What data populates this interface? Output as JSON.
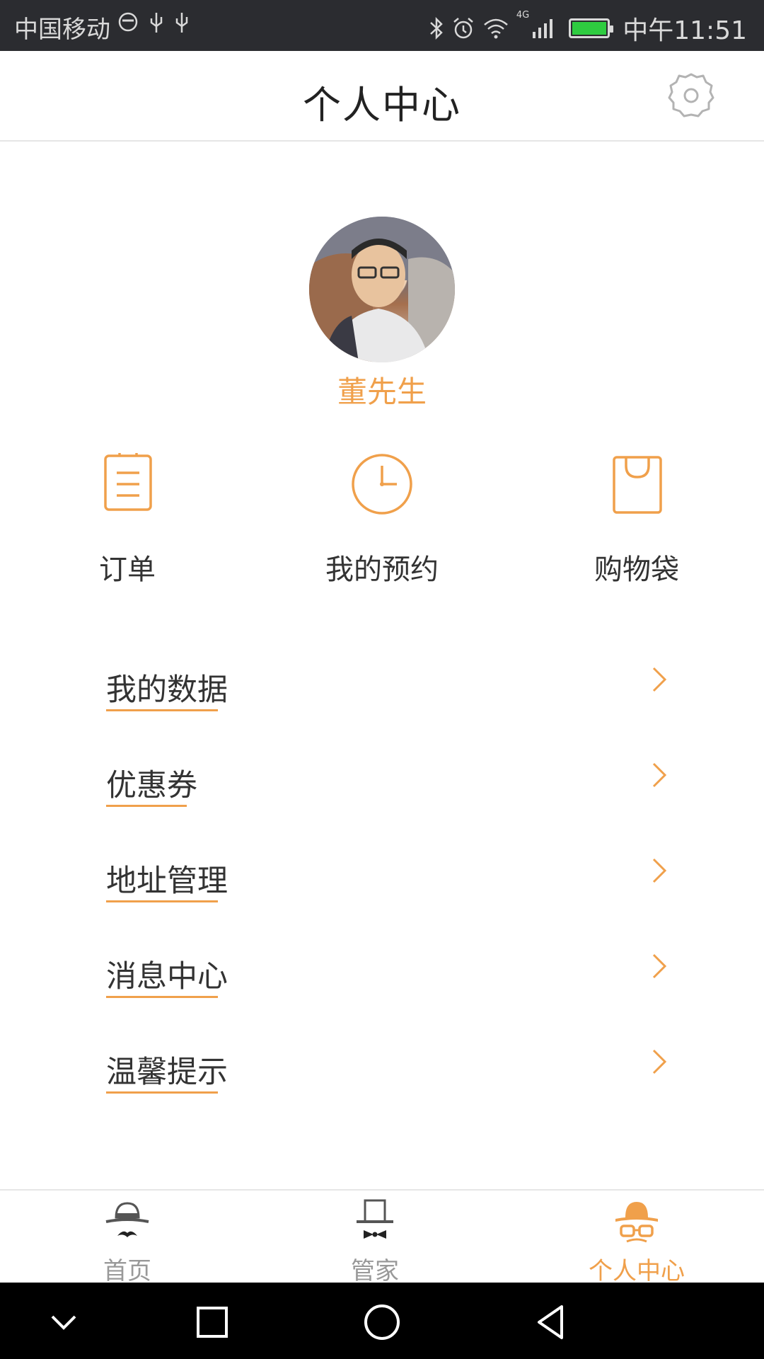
{
  "status_bar": {
    "carrier": "中国移动",
    "network": "4G",
    "time": "中午11:51",
    "battery_color": "#2ecc40"
  },
  "header": {
    "title": "个人中心",
    "settings_icon": "gear-icon"
  },
  "profile": {
    "name": "董先生",
    "name_color": "#f0a04b"
  },
  "quick_actions": [
    {
      "label": "订单",
      "icon": "clipboard-icon"
    },
    {
      "label": "我的预约",
      "icon": "clock-icon"
    },
    {
      "label": "购物袋",
      "icon": "shopping-bag-icon"
    }
  ],
  "menu": [
    {
      "label": "我的数据"
    },
    {
      "label": "优惠券"
    },
    {
      "label": "地址管理"
    },
    {
      "label": "消息中心"
    },
    {
      "label": "温馨提示"
    }
  ],
  "tabs": [
    {
      "label": "首页",
      "icon": "hat-mustache-icon"
    },
    {
      "label": "管家",
      "icon": "top-hat-bowtie-icon"
    },
    {
      "label": "个人中心",
      "icon": "hat-glasses-icon",
      "active": true
    }
  ],
  "accent_color": "#f0a04b"
}
